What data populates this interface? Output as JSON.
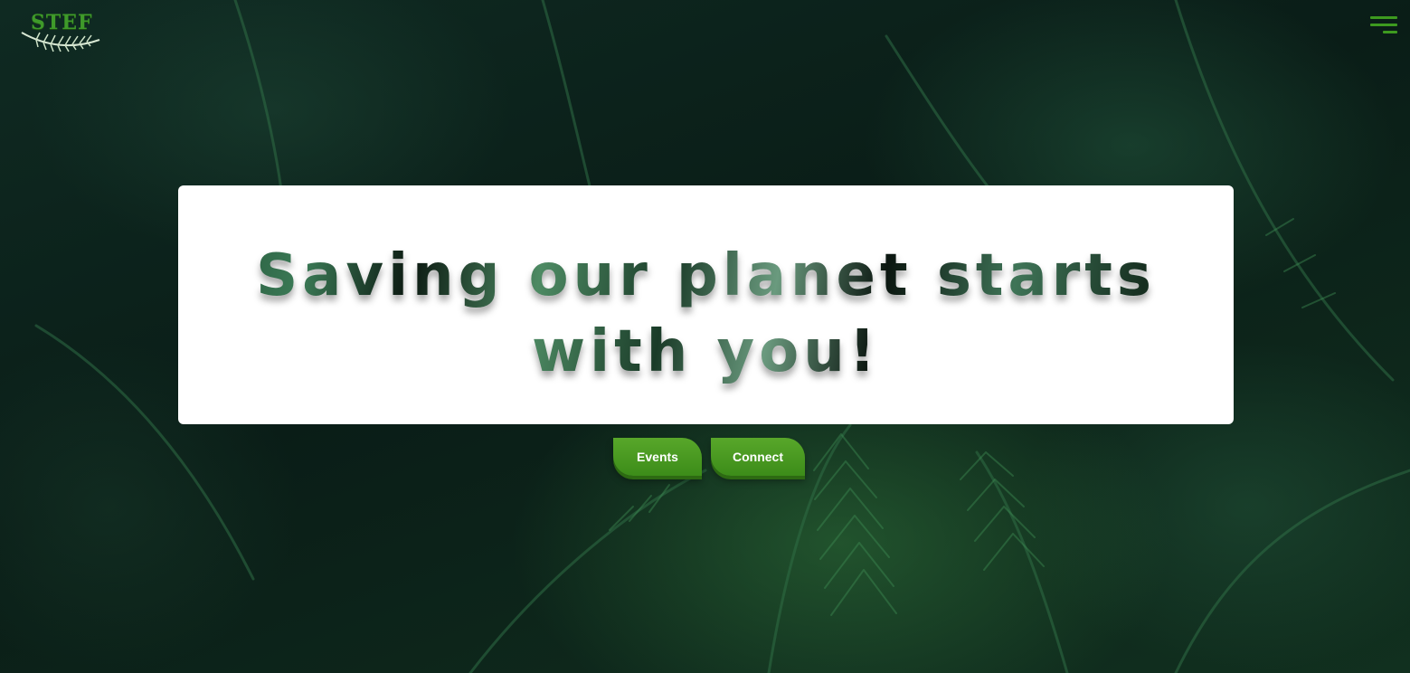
{
  "header": {
    "logo_text": "STEF",
    "menu_icon": "hamburger-menu-icon"
  },
  "hero": {
    "headline": "Saving our planet starts with you!"
  },
  "actions": {
    "events_label": "Events",
    "connect_label": "Connect"
  },
  "colors": {
    "accent_green": "#3d9a1f",
    "button_green": "#4a9a22",
    "card_background": "#ffffff",
    "page_background": "#0b1f18"
  }
}
